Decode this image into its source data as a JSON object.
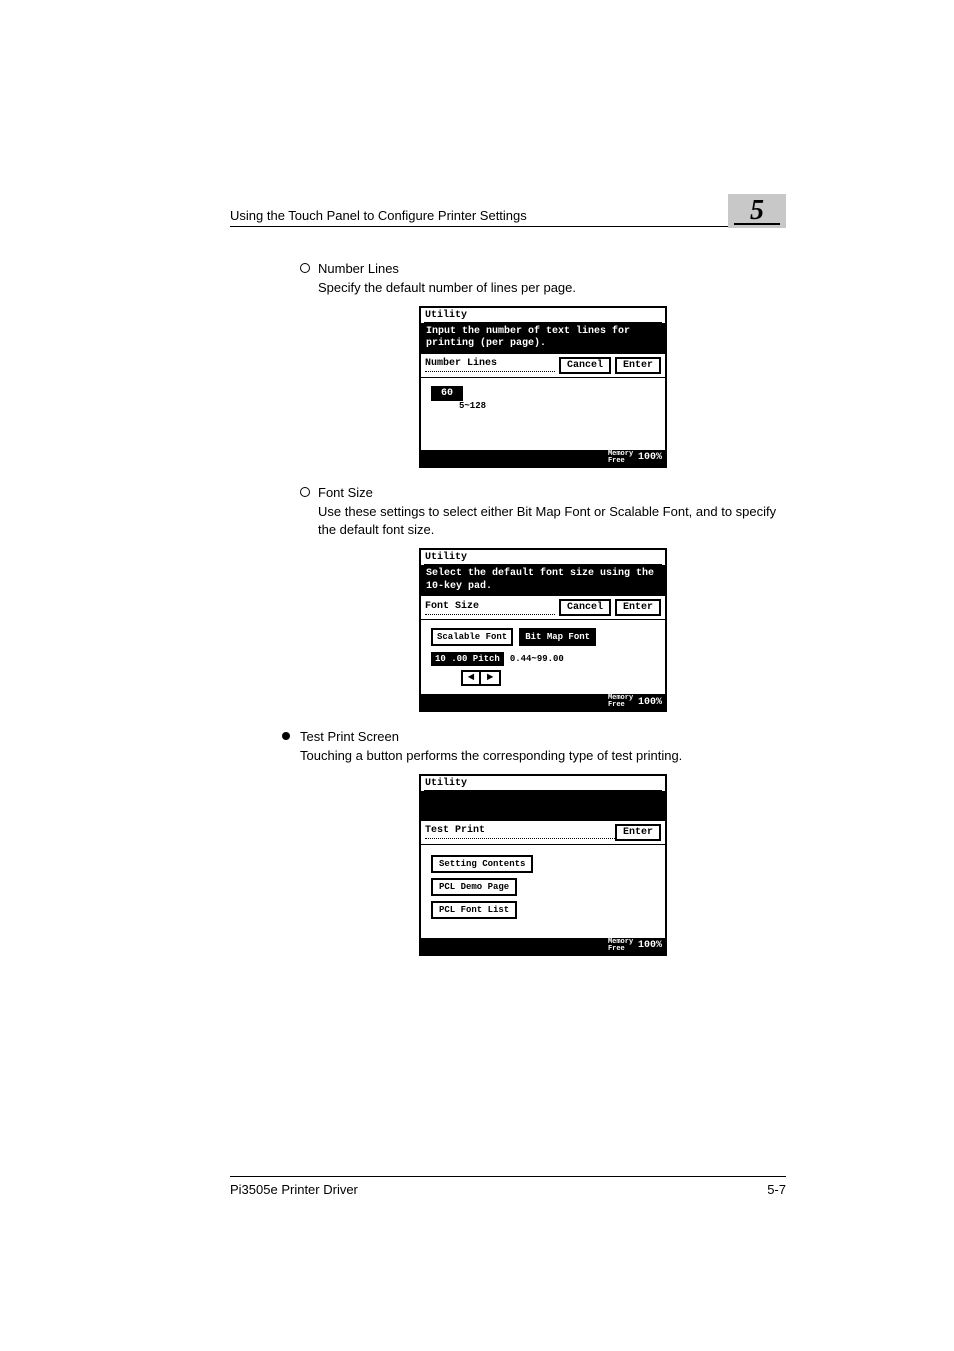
{
  "header": {
    "running_title": "Using the Touch Panel to Configure Printer Settings",
    "chapter_number": "5"
  },
  "items": [
    {
      "bullet": "circle",
      "title": "Number Lines",
      "description": "Specify the default number of lines per page.",
      "panel": {
        "title": "Utility",
        "instruction": "Input the number of text lines for printing (per page).",
        "sublabel": "Number Lines",
        "cancel": "Cancel",
        "enter": "Enter",
        "value": "60",
        "range": "5~128",
        "mem_label": "Memory\nFree",
        "mem_value": "100%"
      }
    },
    {
      "bullet": "circle",
      "title": "Font Size",
      "description": "Use these settings to select either Bit Map Font or Scalable Font, and to specify the default font size.",
      "panel": {
        "title": "Utility",
        "instruction": "Select the default font size using the 10-key pad.",
        "sublabel": "Font Size",
        "cancel": "Cancel",
        "enter": "Enter",
        "opt1": "Scalable Font",
        "opt2": "Bit Map Font",
        "pitch_value": "10 .00 Pitch",
        "pitch_range": "0.44~99.00",
        "mem_label": "Memory\nFree",
        "mem_value": "100%"
      }
    },
    {
      "bullet": "disc",
      "title": "Test Print Screen",
      "description": "Touching a button performs the corresponding type of test printing.",
      "panel": {
        "title": "Utility",
        "sublabel": "Test Print",
        "enter": "Enter",
        "btn1": "Setting Contents",
        "btn2": "PCL Demo Page",
        "btn3": "PCL Font List",
        "mem_label": "Memory\nFree",
        "mem_value": "100%"
      }
    }
  ],
  "footer": {
    "left": "Pi3505e Printer Driver",
    "right": "5-7"
  }
}
